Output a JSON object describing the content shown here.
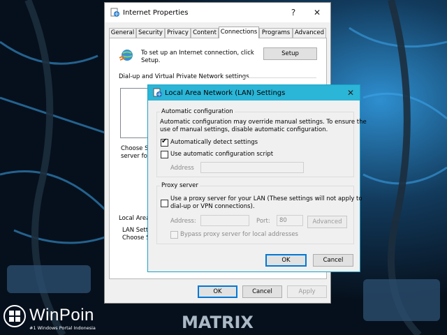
{
  "internet_properties": {
    "title": "Internet Properties",
    "help_glyph": "?",
    "close_glyph": "✕",
    "tabs": [
      "General",
      "Security",
      "Privacy",
      "Content",
      "Connections",
      "Programs",
      "Advanced"
    ],
    "active_tab": "Connections",
    "setup_text_line1": "To set up an Internet connection, click",
    "setup_text_line2": "Setup.",
    "setup_button": "Setup",
    "dialup_heading": "Dial-up and Virtual Private Network settings",
    "choose_line1": "Choose Se",
    "choose_line2": "server for",
    "lan_heading": "Local Area",
    "lan_line1": "LAN Settin",
    "lan_line2": "Choose Se",
    "ok": "OK",
    "cancel": "Cancel",
    "apply": "Apply"
  },
  "lan_settings": {
    "title": "Local Area Network (LAN) Settings",
    "close_glyph": "✕",
    "auto_config": {
      "title": "Automatic configuration",
      "desc_line1": "Automatic configuration may override manual settings.  To ensure the",
      "desc_line2": "use of manual settings, disable automatic configuration.",
      "auto_detect_label": "Automatically detect settings",
      "auto_detect_checked": true,
      "script_label": "Use automatic configuration script",
      "script_checked": false,
      "address_label": "Address",
      "address_value": ""
    },
    "proxy": {
      "title": "Proxy server",
      "use_proxy_line1": "Use a proxy server for your LAN (These settings will not apply to",
      "use_proxy_line2": "dial-up or VPN connections).",
      "use_proxy_checked": false,
      "address_label": "Address:",
      "address_value": "",
      "port_label": "Port:",
      "port_value": "80",
      "advanced": "Advanced",
      "bypass_label": "Bypass proxy server for local addresses",
      "bypass_checked": false
    },
    "ok": "OK",
    "cancel": "Cancel"
  },
  "watermark": {
    "brand": "WinPoin",
    "tagline": "#1 Windows Portal Indonesia"
  },
  "background_text": "MATRIX",
  "colors": {
    "accent": "#0078d7",
    "lan_titlebar": "#2bb5d7",
    "desktop": "#0b1a2a"
  }
}
